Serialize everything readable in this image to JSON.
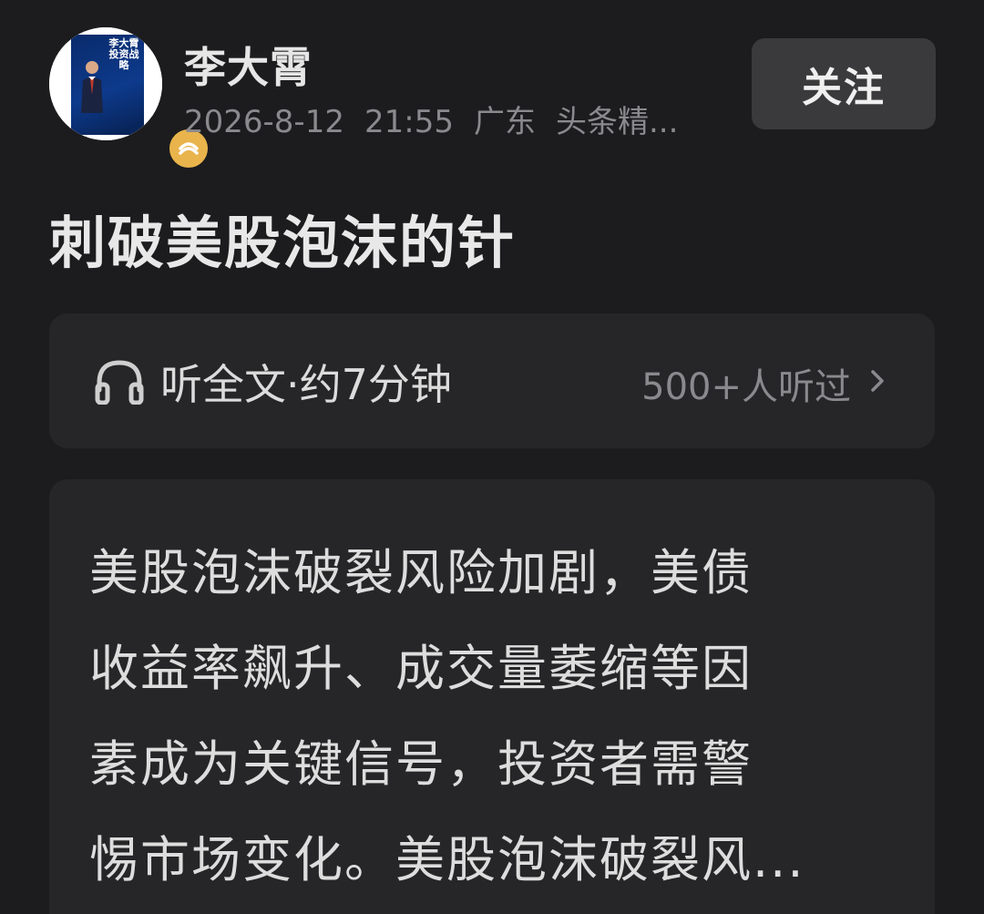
{
  "author": {
    "name": "李大霄",
    "avatar_book_title": "李大霄投资战略",
    "date": "2026-8-12",
    "time": "21:55",
    "location": "广东",
    "source": "头条精..."
  },
  "follow_button": {
    "label": "关注"
  },
  "article": {
    "title": "刺破美股泡沫的针"
  },
  "audio": {
    "label": "听全文·约7分钟",
    "listeners": "500+人听过"
  },
  "content": {
    "lines": [
      "美股泡沫破裂风险加剧，美债",
      "收益率飙升、成交量萎缩等因",
      "素成为关键信号，投资者需警",
      "惕市场变化。美股泡沫破裂风..."
    ]
  },
  "colors": {
    "background": "#1c1c1e",
    "card": "#262628",
    "button": "#3a3a3c",
    "badge": "#e9b44c"
  },
  "icons": {
    "audio": "headphone-icon",
    "more": "chevron-right-icon",
    "verified": "verified-badge-icon"
  }
}
